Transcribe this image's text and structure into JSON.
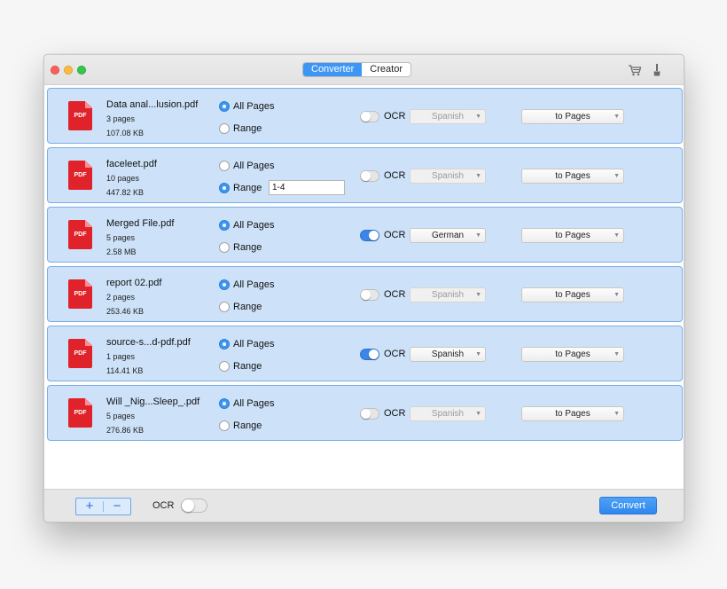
{
  "window": {
    "tabs": [
      {
        "label": "Converter",
        "active": true
      },
      {
        "label": "Creator",
        "active": false
      }
    ],
    "toolbar_icons": [
      "cart-icon",
      "brush-icon"
    ]
  },
  "files": [
    {
      "name": "Data anal...lusion.pdf",
      "pages": "3 pages",
      "size": "107.08 KB",
      "page_option": "All Pages",
      "range_value": "",
      "ocr_on": false,
      "language": "Spanish",
      "language_enabled": false,
      "target": "to Pages"
    },
    {
      "name": "faceleet.pdf",
      "pages": "10 pages",
      "size": "447.82 KB",
      "page_option": "Range",
      "range_value": "1-4",
      "ocr_on": false,
      "language": "Spanish",
      "language_enabled": false,
      "target": "to Pages"
    },
    {
      "name": "Merged File.pdf",
      "pages": "5 pages",
      "size": "2.58 MB",
      "page_option": "All Pages",
      "range_value": "",
      "ocr_on": true,
      "language": "German",
      "language_enabled": true,
      "target": "to Pages"
    },
    {
      "name": "report 02.pdf",
      "pages": "2 pages",
      "size": "253.46 KB",
      "page_option": "All Pages",
      "range_value": "",
      "ocr_on": false,
      "language": "Spanish",
      "language_enabled": false,
      "target": "to Pages"
    },
    {
      "name": "source-s...d-pdf.pdf",
      "pages": "1 pages",
      "size": "114.41 KB",
      "page_option": "All Pages",
      "range_value": "",
      "ocr_on": true,
      "language": "Spanish",
      "language_enabled": true,
      "target": "to Pages"
    },
    {
      "name": "Will _Nig...Sleep_.pdf",
      "pages": "5 pages",
      "size": "276.86 KB",
      "page_option": "All Pages",
      "range_value": "",
      "ocr_on": false,
      "language": "Spanish",
      "language_enabled": false,
      "target": "to Pages"
    }
  ],
  "labels": {
    "all_pages": "All Pages",
    "range": "Range",
    "ocr": "OCR",
    "pdf_badge": "PDF"
  },
  "bottom": {
    "add_label": "+",
    "remove_label": "−",
    "ocr_label": "OCR",
    "ocr_on": false,
    "convert_label": "Convert"
  },
  "colors": {
    "accent": "#3d96f3",
    "row_background": "#cde2f9",
    "pdf_red": "#e0232b"
  }
}
